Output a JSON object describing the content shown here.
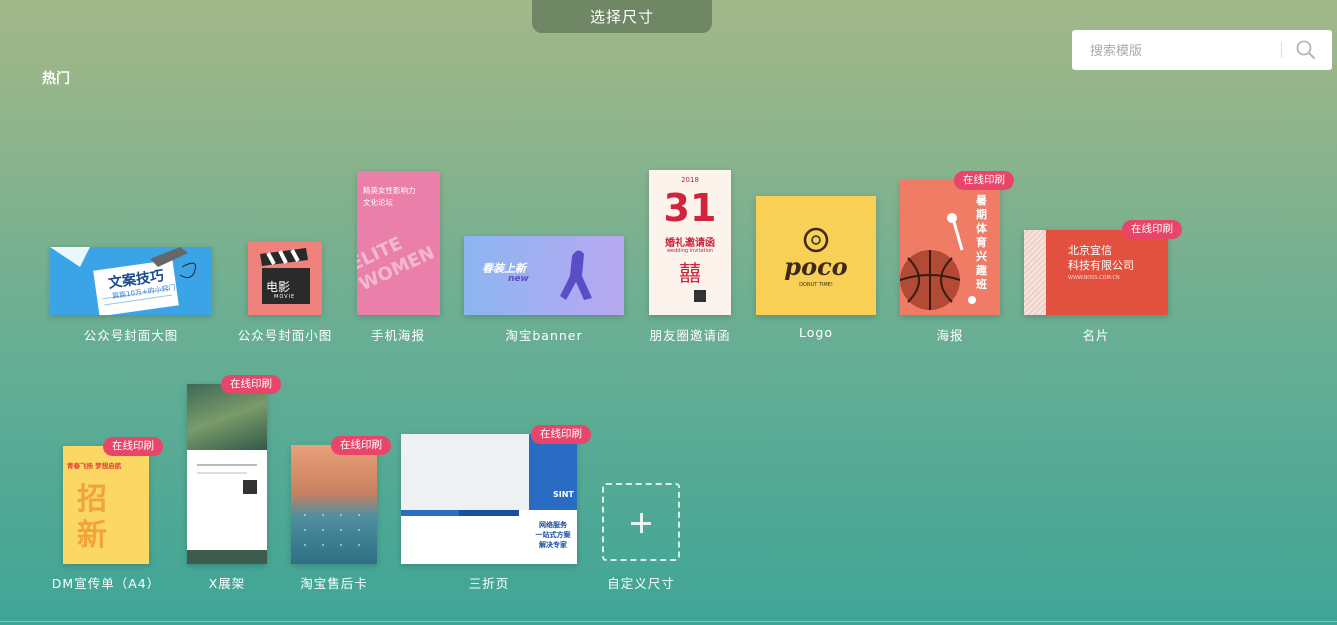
{
  "header": {
    "tab_title": "选择尺寸"
  },
  "search": {
    "placeholder": "搜索模版",
    "value": "",
    "icon": "search-icon"
  },
  "section": {
    "title": "热门"
  },
  "badge_text": "在线印刷",
  "templates": [
    {
      "label": "公众号封面大图",
      "badge": false,
      "title": "文案技巧",
      "subtitle": "篇篇10万+的小窍门"
    },
    {
      "label": "公众号封面小图",
      "badge": false,
      "text1": "电影",
      "text2": "MOVIE"
    },
    {
      "label": "手机海报",
      "badge": false,
      "title": "精英女性影响力",
      "title2": "文化论坛",
      "bg_text": "ELITE WOMEN"
    },
    {
      "label": "淘宝banner",
      "badge": false,
      "title": "春装上新",
      "sub": "new"
    },
    {
      "label": "朋友圈邀请函",
      "badge": false,
      "year": "2018",
      "day": "31",
      "title": "婚礼邀请函",
      "sub": "wedding invitation",
      "seal": "囍"
    },
    {
      "label": "Logo",
      "badge": false,
      "brand": "poco",
      "sub": "DONUT TIME!"
    },
    {
      "label": "海报",
      "badge": true,
      "title": "暑期体育兴趣班"
    },
    {
      "label": "名片",
      "badge": true,
      "company1": "北京宜信",
      "company2": "科技有限公司",
      "url": "WWW.BOSS.COM.CN"
    },
    {
      "label": "DM宣传单（A4）",
      "badge": true,
      "title": "青春飞扬 梦想启航",
      "big": "招新"
    },
    {
      "label": "X展架",
      "badge": true
    },
    {
      "label": "淘宝售后卡",
      "badge": true
    },
    {
      "label": "三折页",
      "badge": true,
      "brand": "SINT",
      "slogan1": "网络服务",
      "slogan2": "一站式方案",
      "slogan3": "解决专家"
    }
  ],
  "custom": {
    "label": "自定义尺寸",
    "icon": "plus-icon"
  },
  "colors": {
    "badge": "#e9456a",
    "tab": "#6f8764",
    "background_top": "#a3b889",
    "background_bottom": "#3fa596"
  }
}
